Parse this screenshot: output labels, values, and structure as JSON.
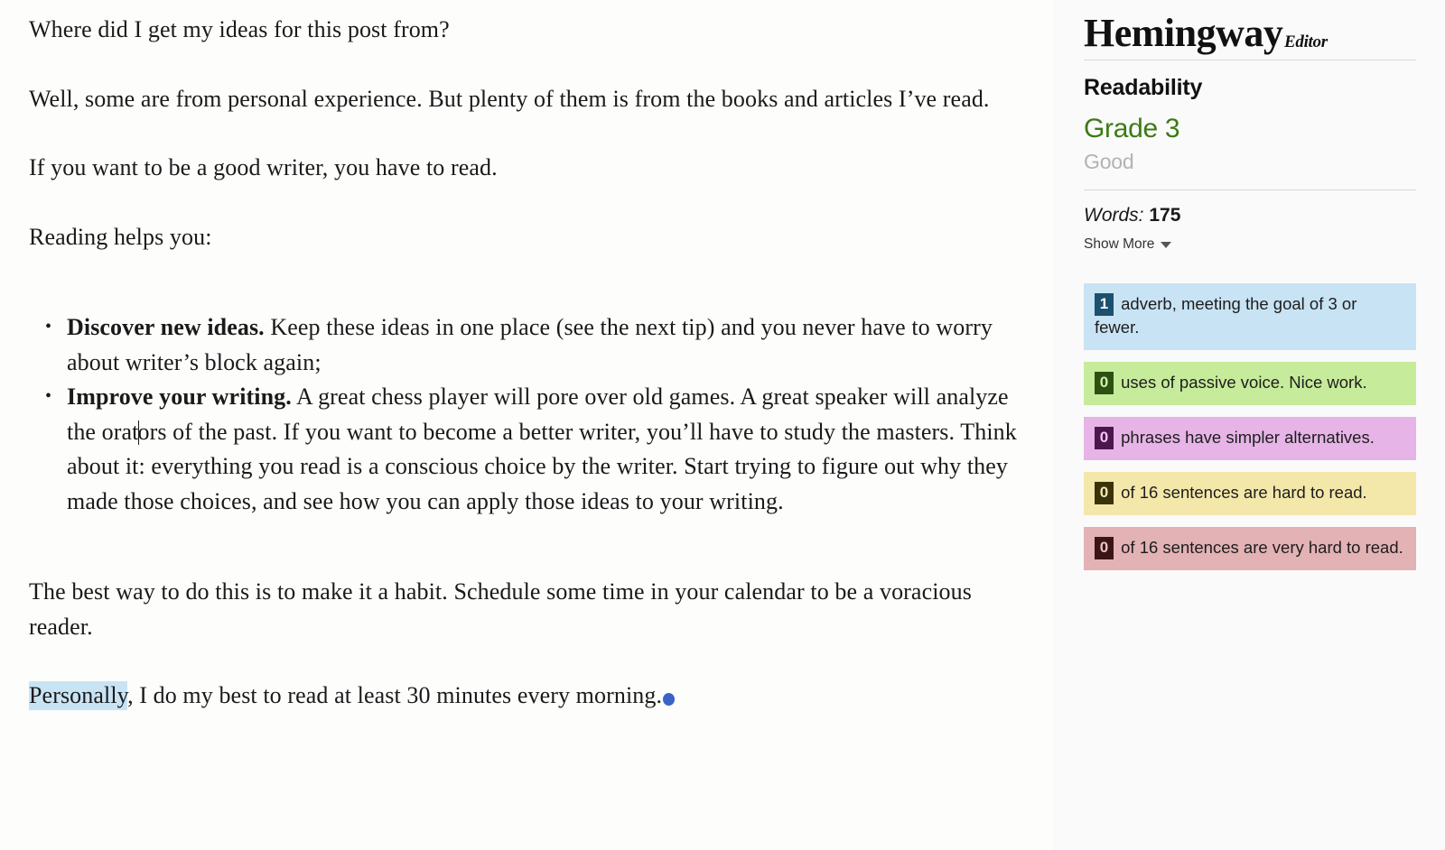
{
  "app": {
    "logo_main": "Hemingway",
    "logo_sub": "Editor"
  },
  "editor": {
    "paragraphs": {
      "p1": "Where did I get my ideas for this post from?",
      "p2": "Well, some are from personal experience. But plenty of them is from the books and articles I’ve read.",
      "p3": "If you want to be a good writer, you have to read.",
      "p4": "Reading helps you:",
      "p5": "The best way to do this is to make it a habit. Schedule some time in your calendar to be a voracious reader.",
      "p6_highlight": "Personally",
      "p6_rest": ", I do my best to read at least 30 minutes every morning."
    },
    "bullets": [
      {
        "lead": "Discover new ideas.",
        "body": " Keep these ideas in one place (see the next tip) and you never have to worry about writer’s block again;"
      },
      {
        "lead": "Improve your writing.",
        "body_before_caret": " A great chess player will pore over old games. A great speaker will analyze the orat",
        "body_after_caret": "ors of the past. If you want to become a better writer, you’ll have to study the masters. Think about it: everything you read is a conscious choice by the writer. Start trying to figure out why they made those choices, and see how you can apply those ideas to your writing."
      }
    ]
  },
  "sidebar": {
    "readability": {
      "heading": "Readability",
      "grade": "Grade 3",
      "quality": "Good",
      "grade_color": "#3c7a16",
      "quality_color": "#b3b3b3"
    },
    "words": {
      "label": "Words:",
      "count": "175",
      "show_more": "Show More",
      "chevron_icon": "chevron-down-icon"
    },
    "stats": [
      {
        "count": "1",
        "text": " adverb, meeting the goal of 3 or fewer.",
        "bg": "#c8e3f4",
        "badge_bg": "#1d4f6e",
        "badge_fg": "#ffffff"
      },
      {
        "count": "0",
        "text": " uses of passive voice. Nice work.",
        "bg": "#c6eb9b",
        "badge_bg": "#2c5211",
        "badge_fg": "#d5f0ad"
      },
      {
        "count": "0",
        "text": " phrases have simpler alternatives.",
        "bg": "#e6b4e6",
        "badge_bg": "#4d154d",
        "badge_fg": "#f0c7f0"
      },
      {
        "count": "0",
        "text": " of 16 sentences are hard to read.",
        "bg": "#f4e7aa",
        "badge_bg": "#3a3209",
        "badge_fg": "#f5eab7"
      },
      {
        "count": "0",
        "text": " of 16 sentences are very hard to read.",
        "bg": "#e3b2b5",
        "badge_bg": "#3b1416",
        "badge_fg": "#edc3c6"
      }
    ]
  }
}
